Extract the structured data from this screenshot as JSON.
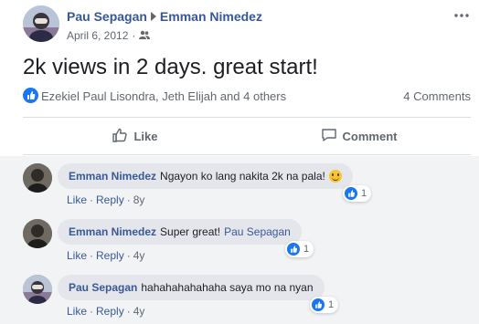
{
  "post": {
    "author": "Pau Sepagan",
    "target": "Emman Nimedez",
    "date": "April 6, 2012",
    "separator": "·",
    "text": "2k views in 2 days. great start!",
    "reactions_summary": "Ezekiel Paul Lisondra, Jeth Elijah and 4 others",
    "comment_count": "4 Comments"
  },
  "actions": {
    "like_label": "Like",
    "comment_label": "Comment"
  },
  "comments": [
    {
      "name": "Emman Nimedez",
      "text": "Ngayon ko lang nakita 2k na pala!",
      "mention": "",
      "like_label": "Like",
      "reply_label": "Reply",
      "age": "8y",
      "reaction_count": "1"
    },
    {
      "name": "Emman Nimedez",
      "text": "Super great!",
      "mention": "Pau Sepagan",
      "like_label": "Like",
      "reply_label": "Reply",
      "age": "4y",
      "reaction_count": "1"
    },
    {
      "name": "Pau Sepagan",
      "text": "hahahahahahaha saya mo na nyan",
      "mention": "",
      "like_label": "Like",
      "reply_label": "Reply",
      "age": "4y",
      "reaction_count": "1"
    }
  ],
  "colors": {
    "link": "#385898",
    "like_blue": "#1877f2",
    "comment_bg": "#f2f3f5",
    "bubble_bg": "#e4e6eb"
  },
  "icons": {
    "privacy": "friends-icon",
    "more": "more-options-icon",
    "like": "thumbs-up-icon",
    "comment": "speech-bubble-icon",
    "emoji": "smiley-emoji-icon"
  }
}
